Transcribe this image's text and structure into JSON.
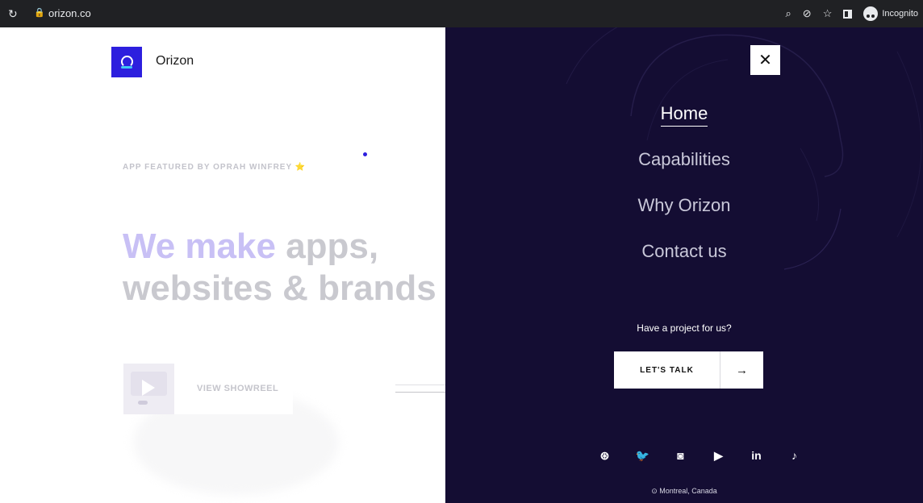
{
  "browser": {
    "url": "orizon.co",
    "incognito_label": "Incognito"
  },
  "brand": {
    "name": "Orizon",
    "logo_color": "#2d1fde"
  },
  "hero": {
    "featured": "APP FEATURED BY OPRAH WINFREY",
    "featured_star": "⭐",
    "headline_accent": "We make",
    "headline_line1_rest": " apps,",
    "headline_line2": "websites & brands",
    "showreel_label": "VIEW SHOWREEL"
  },
  "menu": {
    "close_glyph": "✕",
    "items": [
      {
        "label": "Home",
        "active": true
      },
      {
        "label": "Capabilities",
        "active": false
      },
      {
        "label": "Why Orizon",
        "active": false
      },
      {
        "label": "Contact us",
        "active": false
      }
    ],
    "project_prompt": "Have a project for us?",
    "cta_label": "LET'S TALK",
    "cta_arrow": "→",
    "socials": [
      {
        "name": "dribbble-icon",
        "glyph": "⊛"
      },
      {
        "name": "twitter-icon",
        "glyph": "🐦"
      },
      {
        "name": "instagram-icon",
        "glyph": "◙"
      },
      {
        "name": "youtube-icon",
        "glyph": "▶"
      },
      {
        "name": "linkedin-icon",
        "glyph": "in"
      },
      {
        "name": "tiktok-icon",
        "glyph": "♪"
      }
    ],
    "location": "Montreal, Canada",
    "location_icon": "⊙",
    "background_color": "#140d33"
  }
}
